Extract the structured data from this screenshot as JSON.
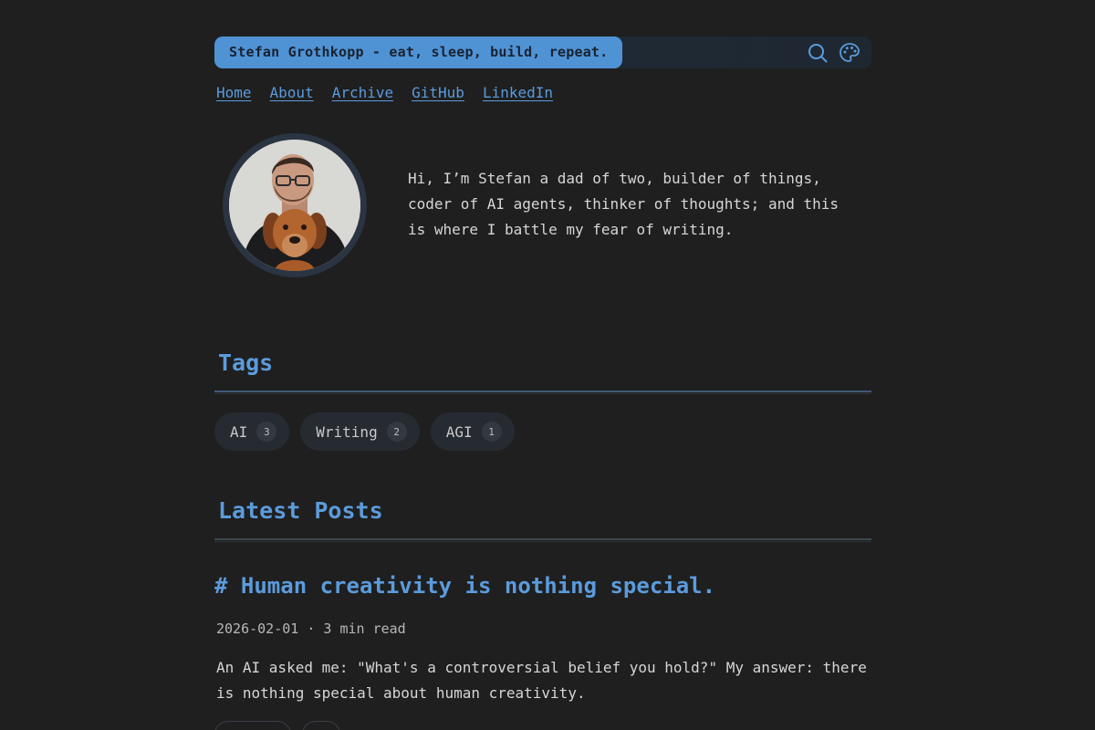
{
  "header": {
    "site_title": "Stefan Grothkopp - eat, sleep, build, repeat.",
    "icons": [
      "search-icon",
      "palette-icon"
    ]
  },
  "nav": [
    {
      "label": "Home"
    },
    {
      "label": "About"
    },
    {
      "label": "Archive"
    },
    {
      "label": "GitHub"
    },
    {
      "label": "LinkedIn"
    }
  ],
  "intro": {
    "text": "Hi, I’m Stefan a dad of two, builder of things, coder of AI agents, thinker of thoughts; and this is where I battle my fear of writing."
  },
  "tags_section": {
    "title": "Tags",
    "tags": [
      {
        "label": "AI",
        "count": "3"
      },
      {
        "label": "Writing",
        "count": "2"
      },
      {
        "label": "AGI",
        "count": "1"
      }
    ]
  },
  "posts_section": {
    "title": "Latest Posts",
    "posts": [
      {
        "title": "# Human creativity is nothing special.",
        "meta": "2026-02-01 · 3 min read",
        "excerpt": "An AI asked me: \"What's a controversial belief you hold?\" My answer: there is nothing special about human creativity."
      }
    ]
  },
  "colors": {
    "background": "#1f1f1f",
    "accent": "#5b9bdc",
    "title_pill": "#4f93d5"
  }
}
